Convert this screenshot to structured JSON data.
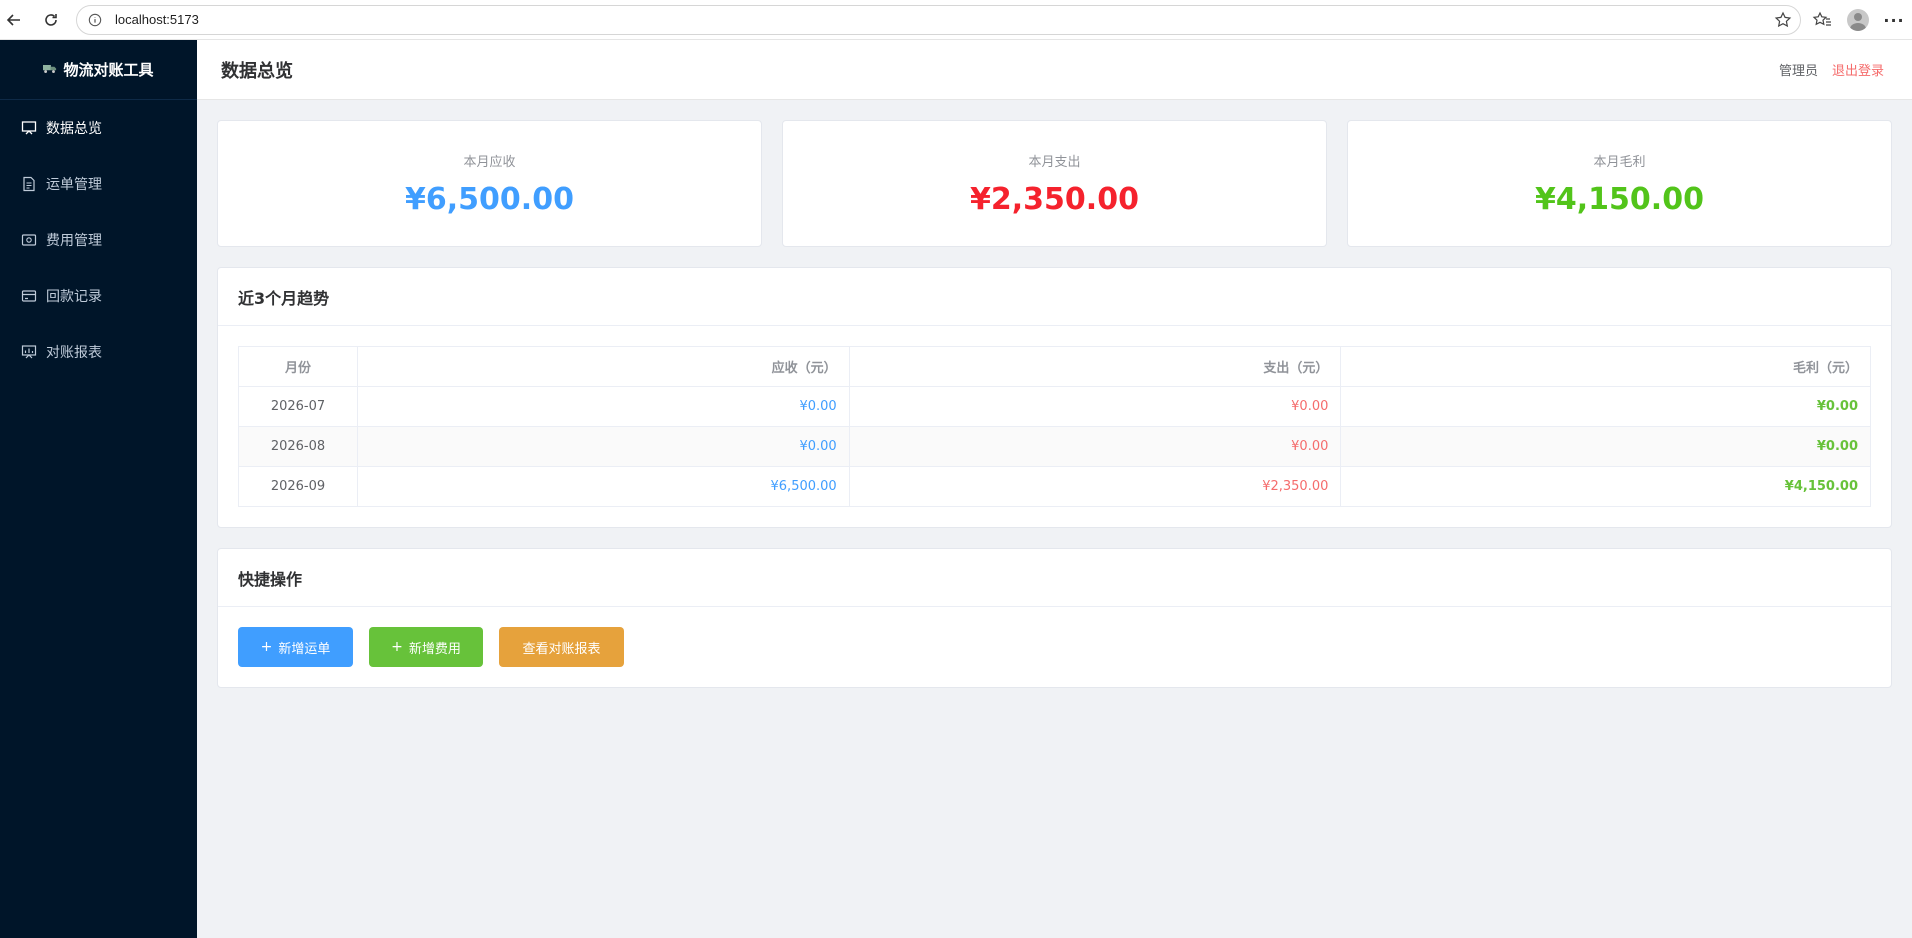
{
  "browser": {
    "url": "localhost:5173"
  },
  "sidebar": {
    "brand": "物流对账工具",
    "items": [
      {
        "label": "数据总览",
        "icon": "monitor-icon",
        "active": true
      },
      {
        "label": "运单管理",
        "icon": "document-icon",
        "active": false
      },
      {
        "label": "费用管理",
        "icon": "wallet-icon",
        "active": false
      },
      {
        "label": "回款记录",
        "icon": "credit-card-icon",
        "active": false
      },
      {
        "label": "对账报表",
        "icon": "report-icon",
        "active": false
      }
    ]
  },
  "header": {
    "title": "数据总览",
    "user": "管理员",
    "logout": "退出登录"
  },
  "stats": [
    {
      "label": "本月应收",
      "value": "¥6,500.00",
      "color": "#409eff"
    },
    {
      "label": "本月支出",
      "value": "¥2,350.00",
      "color": "#f5222d"
    },
    {
      "label": "本月毛利",
      "value": "¥4,150.00",
      "color": "#52c41a"
    }
  ],
  "trend": {
    "title": "近3个月趋势",
    "columns": [
      "月份",
      "应收（元）",
      "支出（元）",
      "毛利（元）"
    ],
    "rows": [
      {
        "month": "2026-07",
        "receivable": "¥0.00",
        "expense": "¥0.00",
        "profit": "¥0.00"
      },
      {
        "month": "2026-08",
        "receivable": "¥0.00",
        "expense": "¥0.00",
        "profit": "¥0.00"
      },
      {
        "month": "2026-09",
        "receivable": "¥6,500.00",
        "expense": "¥2,350.00",
        "profit": "¥4,150.00"
      }
    ]
  },
  "quick": {
    "title": "快捷操作",
    "add_waybill": "新增运单",
    "add_fee": "新增费用",
    "view_report": "查看对账报表",
    "plus": "+"
  }
}
